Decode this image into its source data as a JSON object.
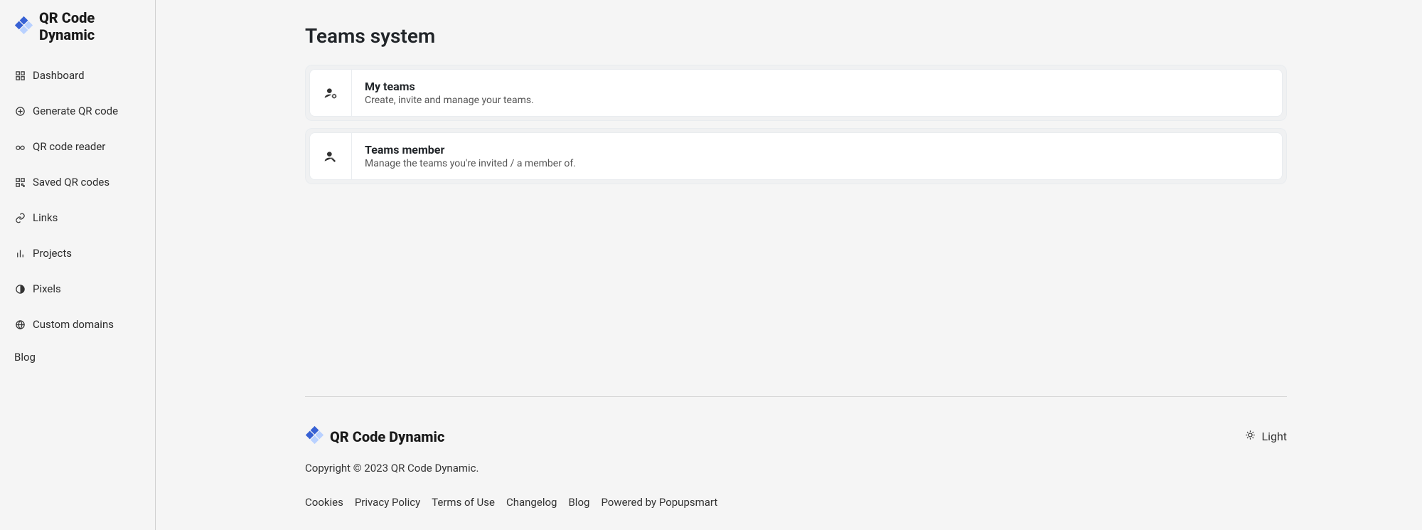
{
  "logo": {
    "text": "QR Code Dynamic"
  },
  "sidebar": {
    "items": [
      {
        "label": "Dashboard"
      },
      {
        "label": "Generate QR code"
      },
      {
        "label": "QR code reader"
      },
      {
        "label": "Saved QR codes"
      },
      {
        "label": "Links"
      },
      {
        "label": "Projects"
      },
      {
        "label": "Pixels"
      },
      {
        "label": "Custom domains"
      }
    ],
    "blog_label": "Blog"
  },
  "main": {
    "title": "Teams system",
    "cards": [
      {
        "title": "My teams",
        "desc": "Create, invite and manage your teams."
      },
      {
        "title": "Teams member",
        "desc": "Manage the teams you're invited / a member of."
      }
    ]
  },
  "footer": {
    "logo_text": "QR Code Dynamic",
    "theme_label": "Light",
    "copyright": "Copyright © 2023 QR Code Dynamic.",
    "links": [
      "Cookies",
      "Privacy Policy",
      "Terms of Use",
      "Changelog",
      "Blog",
      "Powered by Popupsmart"
    ]
  }
}
